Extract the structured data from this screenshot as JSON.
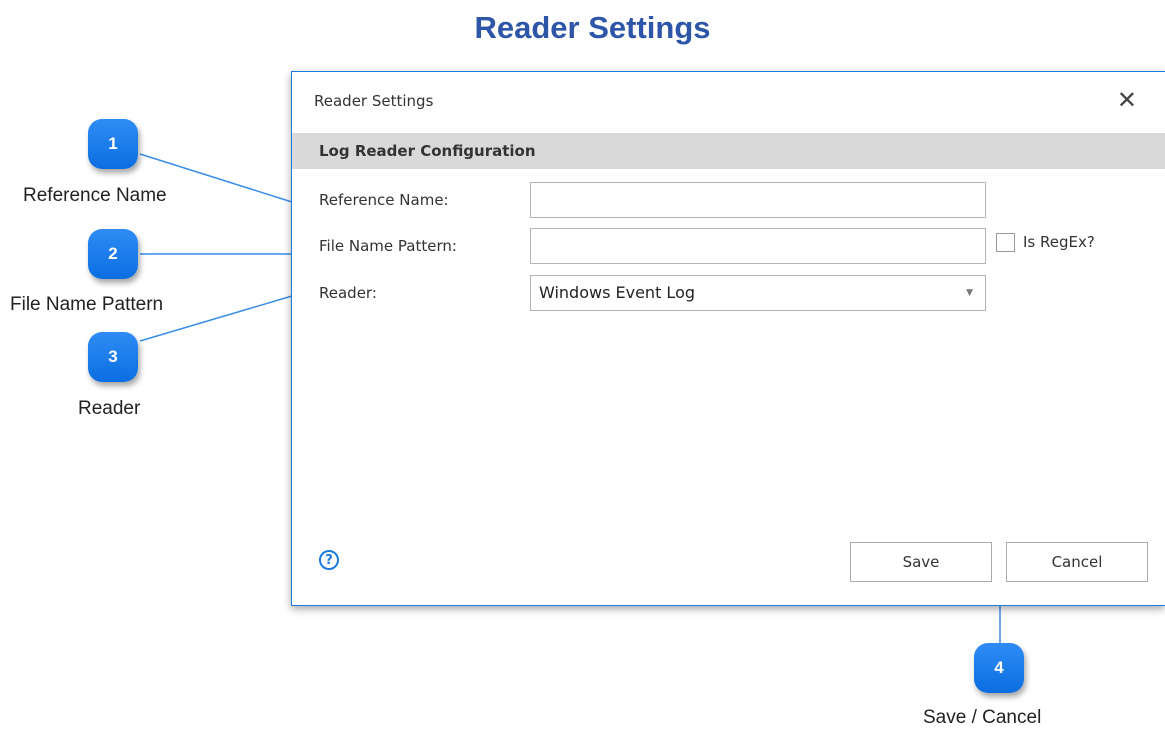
{
  "page_title": "Reader Settings",
  "callouts": [
    {
      "number": "1",
      "label": "Reference Name"
    },
    {
      "number": "2",
      "label": "File Name Pattern"
    },
    {
      "number": "3",
      "label": "Reader"
    },
    {
      "number": "4",
      "label": "Save / Cancel"
    }
  ],
  "dialog": {
    "title": "Reader Settings",
    "close_icon": "close-icon",
    "section_header": "Log Reader Configuration",
    "fields": {
      "reference_name": {
        "label": "Reference Name:",
        "value": ""
      },
      "file_name_pattern": {
        "label": "File Name Pattern:",
        "value": ""
      },
      "regex_checkbox": {
        "label": "Is RegEx?",
        "checked": false
      },
      "reader": {
        "label": "Reader:",
        "selected": "Windows Event Log"
      }
    },
    "help_icon": "help-icon",
    "buttons": {
      "save": "Save",
      "cancel": "Cancel"
    }
  },
  "colors": {
    "title": "#2e56a8",
    "badge": "#1677e8",
    "connector": "#3a8ee6",
    "dialog_border": "#1c7ae0",
    "section_header_bg": "#d9d9d9"
  }
}
